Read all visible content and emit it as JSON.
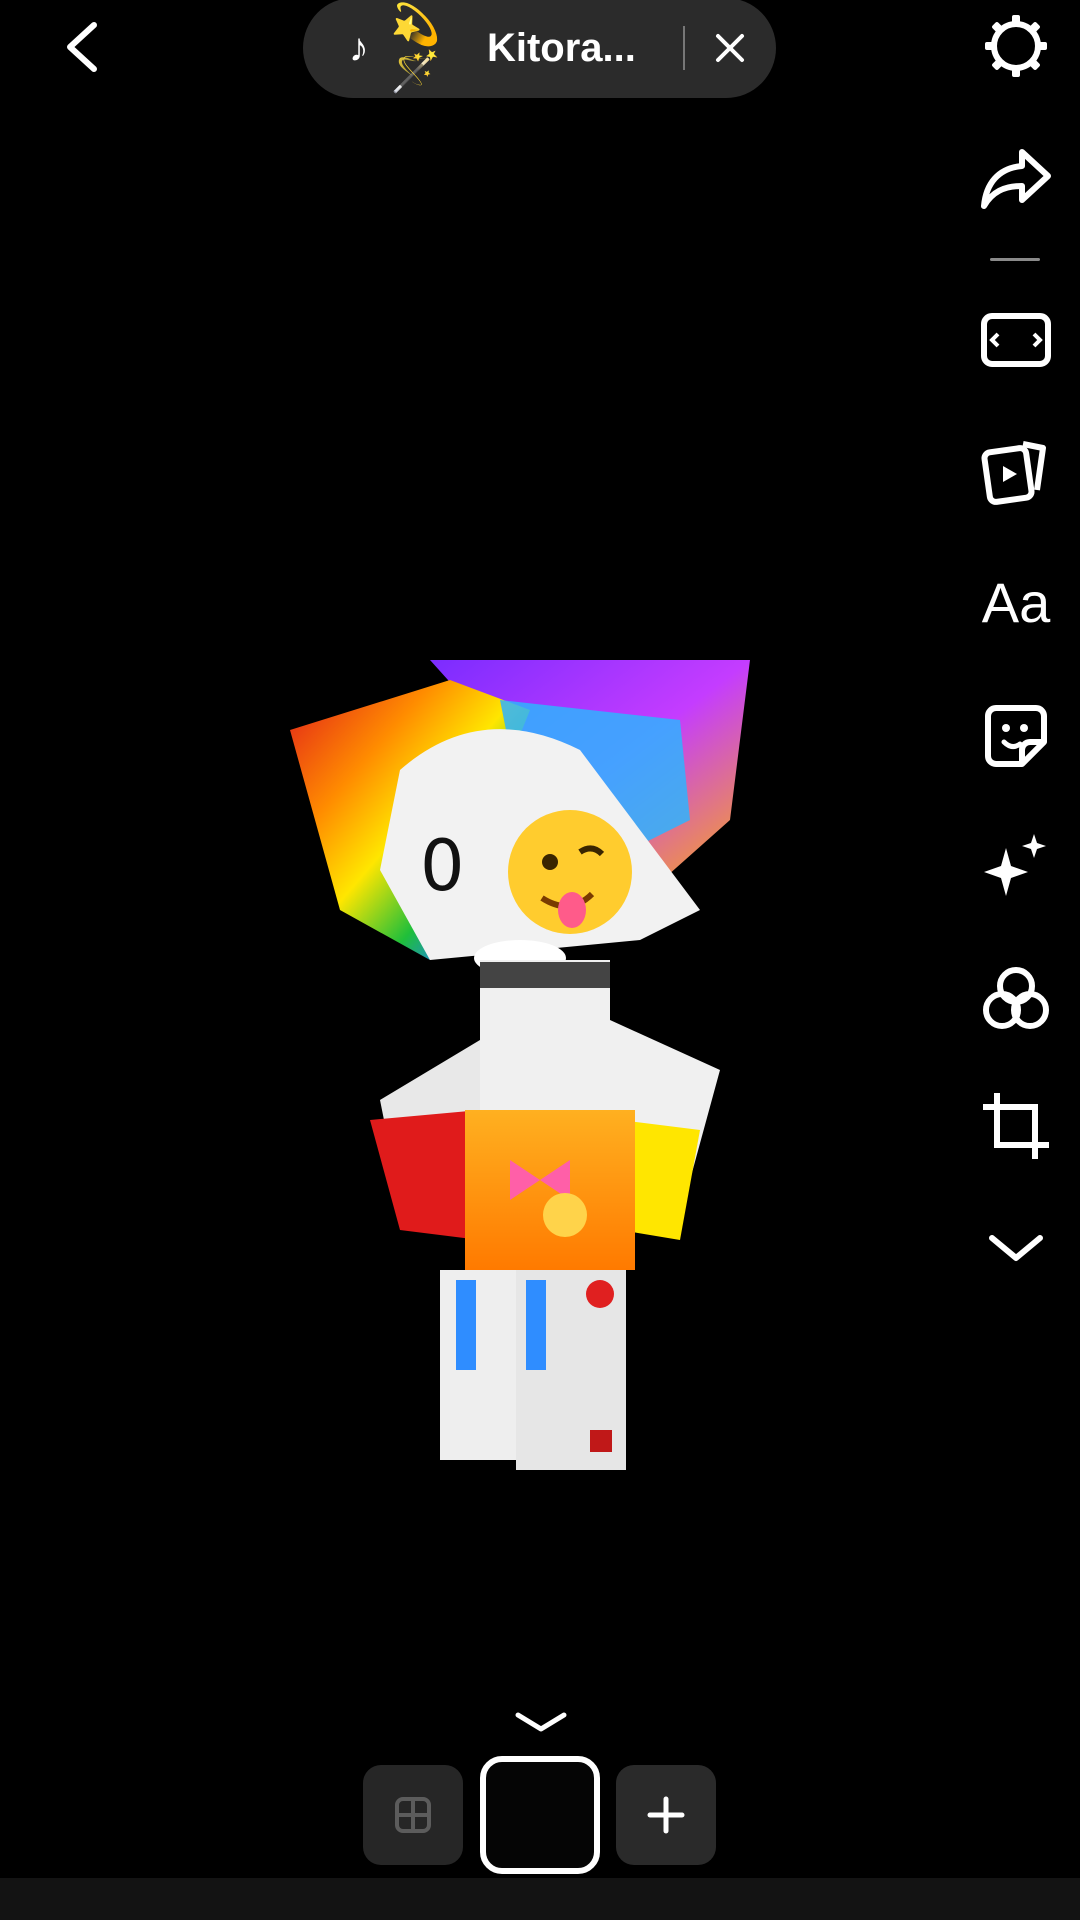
{
  "header": {
    "back_icon": "chevron-left-icon",
    "sound": {
      "note_icon": "music-note-icon",
      "emoji": "💫🪄",
      "title": "Kitora...",
      "close_icon": "close-icon"
    }
  },
  "tools": [
    {
      "name": "settings",
      "icon": "gear-icon"
    },
    {
      "name": "share",
      "icon": "share-arrow-icon"
    },
    {
      "name": "aspect-ratio",
      "icon": "aspect-ratio-icon"
    },
    {
      "name": "templates",
      "icon": "video-cards-icon"
    },
    {
      "name": "text",
      "label": "Aa",
      "icon": "text-icon"
    },
    {
      "name": "stickers",
      "icon": "sticker-icon"
    },
    {
      "name": "effects",
      "icon": "sparkle-icon"
    },
    {
      "name": "filters",
      "icon": "filters-icon"
    },
    {
      "name": "crop",
      "icon": "crop-icon"
    },
    {
      "name": "more",
      "icon": "chevron-down-icon"
    }
  ],
  "bottom": {
    "collapse_icon": "chevron-down-icon",
    "grid_icon": "grid-icon",
    "add_icon": "plus-icon"
  },
  "colors": {
    "background": "#000000",
    "pill": "#2b2b2b",
    "tray_button": "#262626"
  }
}
